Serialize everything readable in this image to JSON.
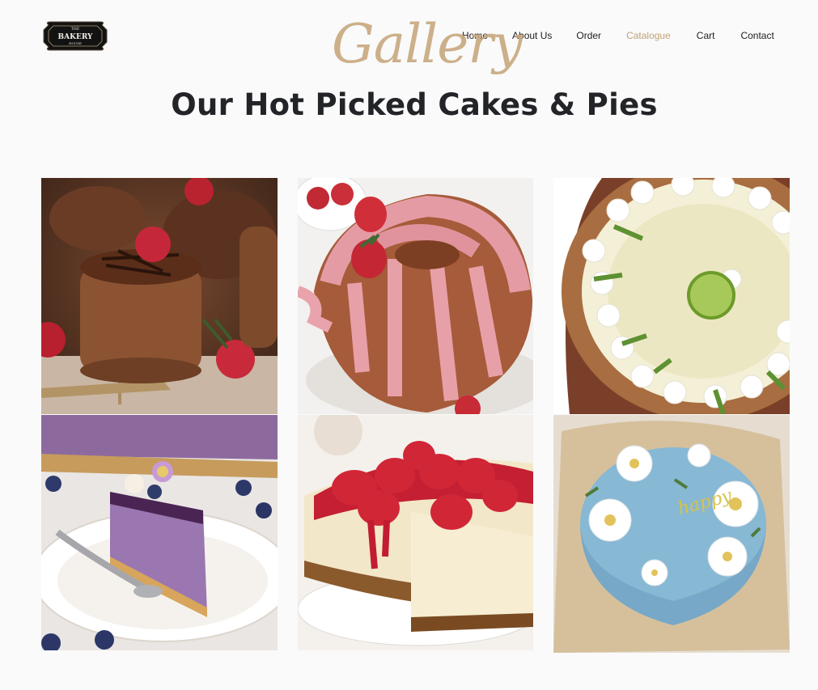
{
  "brand": {
    "logo_top": "THE",
    "logo_name": "BAKERY",
    "logo_bottom": "HOUSE",
    "logo_icon": "bakery-badge-icon"
  },
  "nav": {
    "items": [
      "Home",
      "About Us",
      "Order",
      "Catalogue",
      "Cart",
      "Contact"
    ],
    "active": "Catalogue"
  },
  "hero": {
    "script": "Gallery",
    "title": "Our Hot Picked Cakes & Pies"
  },
  "gallery": [
    {
      "subject": "chocolate mousse cakes with raspberries"
    },
    {
      "subject": "bundt cake with pink glaze and strawberries"
    },
    {
      "subject": "key lime pie with whipped cream and lime slices"
    },
    {
      "subject": "blueberry cheesecake slice with flowers"
    },
    {
      "subject": "strawberry cheesecake"
    },
    {
      "subject": "blue cake with daisies and happy lettering"
    }
  ],
  "colors": {
    "accent": "#c2a176",
    "heading": "#222428",
    "script": "#c8a97e",
    "background": "#fafafa"
  }
}
